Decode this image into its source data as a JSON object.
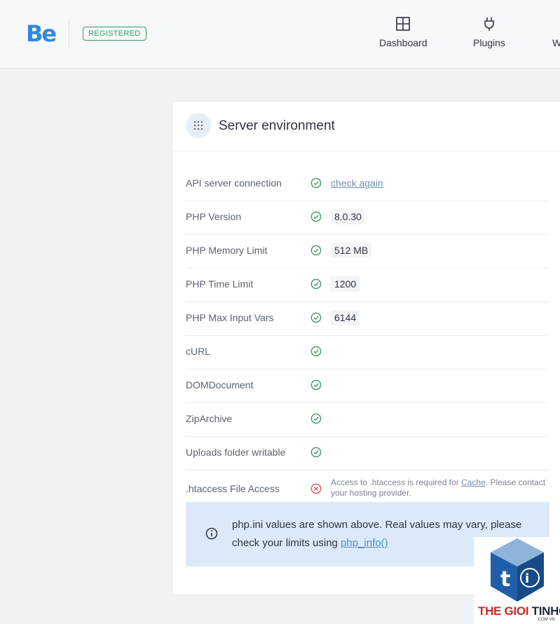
{
  "header": {
    "logo": "Be",
    "badge": "REGISTERED",
    "nav": [
      {
        "label": "Dashboard",
        "icon": "dashboard-icon"
      },
      {
        "label": "Plugins",
        "icon": "plug-icon"
      },
      {
        "label": "W",
        "icon": ""
      }
    ]
  },
  "card": {
    "title": "Server environment",
    "icon": "grid-dots-icon",
    "rows": [
      {
        "label": "API server connection",
        "status": "ok",
        "link": "check again"
      },
      {
        "label": "PHP Version",
        "status": "ok",
        "value": "8.0.30"
      },
      {
        "label": "PHP Memory Limit",
        "status": "ok",
        "value": "512 MB"
      },
      {
        "label": "PHP Time Limit",
        "status": "ok",
        "value": "1200"
      },
      {
        "label": "PHP Max Input Vars",
        "status": "ok",
        "value": "6144"
      },
      {
        "label": "cURL",
        "status": "ok"
      },
      {
        "label": "DOMDocument",
        "status": "ok"
      },
      {
        "label": "ZipArchive",
        "status": "ok"
      },
      {
        "label": "Uploads folder writable",
        "status": "ok"
      },
      {
        "label": ".htaccess File Access",
        "status": "error",
        "note_before": "Access to .htaccess is required for ",
        "note_link": "Cache",
        "note_after": ". Please contact your hosting provider."
      }
    ],
    "info": {
      "text_before": "php.ini values are shown above. Real values may vary, please check your limits using ",
      "link": "php_info()"
    }
  },
  "watermark": {
    "text_a": "THE GIOI ",
    "text_b": "TINHOC",
    "sub": ".COM.VN"
  },
  "colors": {
    "ok": "#3b9a64",
    "error": "#d9534f",
    "accent": "#2f88e6",
    "info_bg": "#dceaf8"
  }
}
